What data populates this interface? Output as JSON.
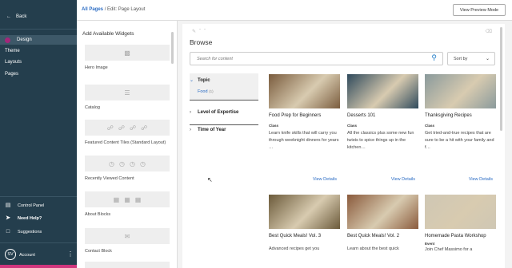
{
  "sidebar": {
    "back_label": "Back",
    "nav": [
      {
        "label": "Design",
        "icon": "design-icon",
        "active": true
      },
      {
        "label": "Theme"
      },
      {
        "label": "Layouts"
      },
      {
        "label": "Pages"
      }
    ],
    "bottom": [
      {
        "label": "Control Panel",
        "icon": "control-panel-icon"
      },
      {
        "label": "Need Help?",
        "icon": "rocket-icon"
      },
      {
        "label": "Suggestions",
        "icon": "chat-icon"
      }
    ],
    "account": {
      "initials": "SV",
      "label": "Account"
    },
    "colors": {
      "bg": "#243e4d",
      "accent": "#d0367d"
    }
  },
  "header": {
    "breadcrumb_root": "All Pages",
    "breadcrumb_sep": "/",
    "breadcrumb_current": "Edit: Page Layout",
    "preview_button": "View Preview Mode"
  },
  "widgets": {
    "title": "Add Available Widgets",
    "items": [
      {
        "label": "Hero Image",
        "icon": "image-icon"
      },
      {
        "label": "Catalog",
        "icon": "lines-icon"
      },
      {
        "label": "Featured Content Tiles (Standard Layout)",
        "icon": "link-icon"
      },
      {
        "label": "Recently Viewed Content",
        "icon": "clock-icon"
      },
      {
        "label": "About Blocks",
        "icon": "blocks-icon"
      },
      {
        "label": "Contact Block",
        "icon": "mail-icon"
      }
    ]
  },
  "browse": {
    "title": "Browse",
    "search_placeholder": "Search for content",
    "sort_label": "Sort by",
    "facets": {
      "topic": "Topic",
      "topic_link": "Food",
      "topic_count": "(1)",
      "level": "Level of Expertise",
      "time": "Time of Year"
    },
    "view_label": "View Details",
    "cards": [
      {
        "title": "Food Prep for Beginners",
        "type": "Class",
        "desc": "Learn knife skills that will carry you through weeknight dinners for years …",
        "img": "#7a5c3e"
      },
      {
        "title": "Desserts 101",
        "type": "Class",
        "desc": "All the classics plus some new fun twists to spice things up in the kitchen…",
        "img": "#2f4a5c"
      },
      {
        "title": "Thanksgiving Recipes",
        "type": "Class",
        "desc": "Get tried-and-true recipes that are sure to be a hit with your family and f…",
        "img": "#8a9a9c"
      },
      {
        "title": "Best Quick Meals! Vol. 3",
        "type": "Class",
        "desc": "Advanced recipes get you",
        "img": "#6b5a3a"
      },
      {
        "title": "Best Quick Meals! Vol. 2",
        "type": "Class",
        "desc": "Learn about the best quick",
        "img": "#8a5a3c"
      },
      {
        "title": "Homemade Pasta Workshop",
        "type": "Event",
        "desc": "Join Chef Massimo for a",
        "img": "#cfc7b4"
      }
    ]
  }
}
